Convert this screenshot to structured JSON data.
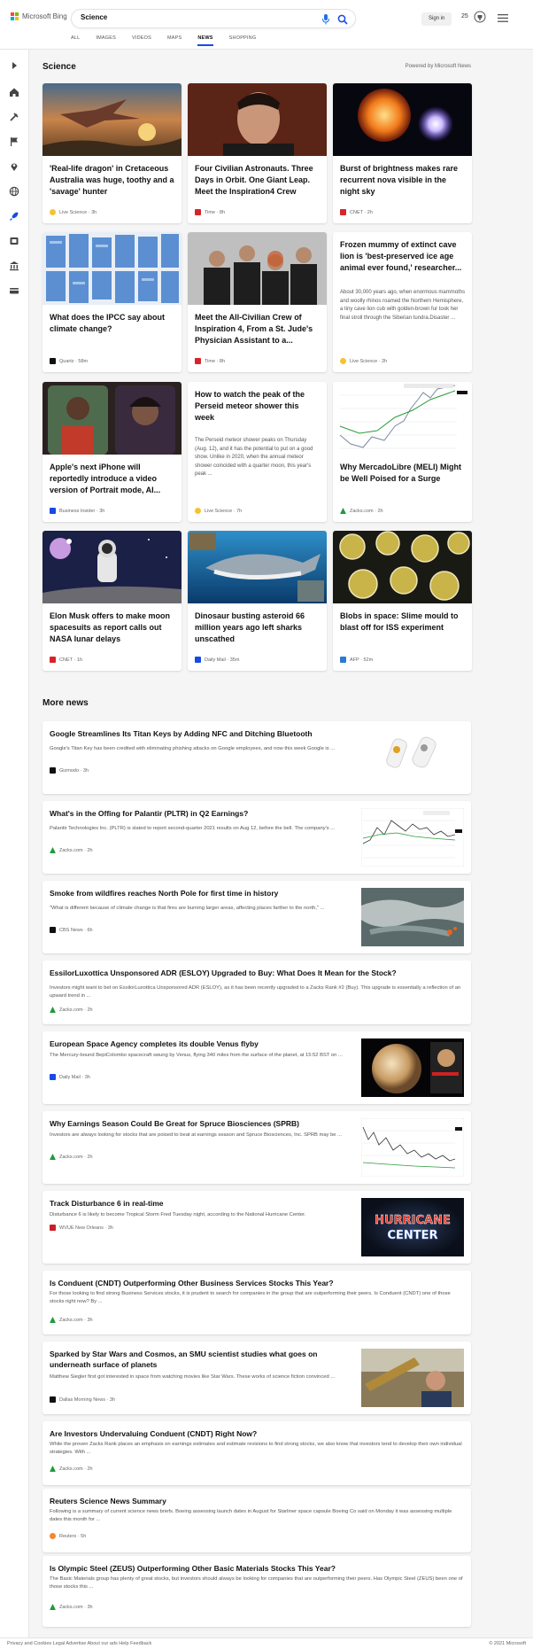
{
  "header": {
    "logo_text": "Microsoft Bing",
    "search_value": "Science",
    "signin_label": "Sign in",
    "points": "25",
    "nav": [
      "ALL",
      "IMAGES",
      "VIDEOS",
      "MAPS",
      "NEWS",
      "SHOPPING"
    ],
    "active_nav": "NEWS"
  },
  "colors": {
    "accent": "#174ae4",
    "zacks_green": "#1e9b3b",
    "cnet_red": "#d8232a"
  },
  "sidebar_icons": [
    "arrow-right-icon",
    "home-icon",
    "tools-icon",
    "flag-icon",
    "location-icon",
    "globe-icon",
    "rocket-icon",
    "media-icon",
    "building-icon",
    "card-icon"
  ],
  "science": {
    "title": "Science",
    "powered_by": "Powered by Microsoft News",
    "cards": [
      {
        "title": "'Real-life dragon' in Cretaceous Australia was huge, toothy and a 'savage' hunter",
        "source": "Live Science · 3h",
        "image": "pterosaur-sunset"
      },
      {
        "title": "Four Civilian Astronauts. Three Days in Orbit. One Giant Leap. Meet the Inspiration4 Crew",
        "source": "Time · 8h",
        "image": "astronaut-portrait"
      },
      {
        "title": "Burst of brightness makes rare recurrent nova visible in the night sky",
        "source": "CNET · 2h",
        "image": "nova-star"
      },
      {
        "title": "What does the IPCC say about climate change?",
        "source": "Quartz · 58m",
        "image": "ipcc-report-pages"
      },
      {
        "title": "Meet the All-Civilian Crew of Inspiration 4, From a St. Jude's Physician Assistant to a...",
        "source": "Time · 8h",
        "image": "crew-photo"
      },
      {
        "title": "Frozen mummy of extinct cave lion is 'best-preserved ice age animal ever found,' researcher...",
        "snippet": "About 30,000 years ago, when enormous mammoths and woolly rhinos roamed the Northern Hemisphere, a tiny cave lion cub with golden-brown fur took her final stroll through the Siberian tundra.Disaster ...",
        "source": "Live Science · 2h"
      },
      {
        "title": "Apple's next iPhone will reportedly introduce a video version of Portrait mode, AI...",
        "source": "Business Insider · 3h",
        "image": "portrait-mode-phones"
      },
      {
        "title": "How to watch the peak of the Perseid meteor shower this week",
        "snippet": "The Perseid meteor shower peaks on Thursday (Aug. 12), and it has the potential to put on a good show. Unlike in 2020, when the annual meteor shower coincided with a quarter moon, this year's peak ...",
        "source": "Live Science · 7h"
      },
      {
        "title": "Why MercadoLibre (MELI) Might be Well Poised for a Surge",
        "source": "Zacks.com · 2h",
        "image": "stock-chart"
      },
      {
        "title": "Elon Musk offers to make moon spacesuits as report calls out NASA lunar delays",
        "source": "CNET · 1h",
        "image": "moon-astronaut"
      },
      {
        "title": "Dinosaur busting asteroid 66 million years ago left sharks unscathed",
        "source": "Daily Mail · 35m",
        "image": "shark"
      },
      {
        "title": "Blobs in space: Slime mould to blast off for ISS experiment",
        "source": "AFP · 52m",
        "image": "petri-dishes"
      }
    ]
  },
  "more_news": {
    "title": "More news",
    "items": [
      {
        "title": "Google Streamlines Its Titan Keys by Adding NFC and Ditching Bluetooth",
        "snippet": "Google's Titan Key has been credited with eliminating phishing attacks on Google employees, and now this week Google is ...",
        "source": "Gizmodo · 3h",
        "image": "titan-keys"
      },
      {
        "title": "What's in the Offing for Palantir (PLTR) in Q2 Earnings?",
        "snippet": "Palantir Technologies Inc. (PLTR) is slated to report second-quarter 2021 results on Aug 12, before the bell. The company's ...",
        "source": "Zacks.com · 2h",
        "image": "stock-chart"
      },
      {
        "title": "Smoke from wildfires reaches North Pole for first time in history",
        "snippet": "\"What is different because of climate change is that fires are burning larger areas, affecting places farther to the north,\" ...",
        "source": "CBS News · 6h",
        "image": "satellite-smoke"
      },
      {
        "title": "EssilorLuxottica Unsponsored ADR (ESLOY) Upgraded to Buy: What Does It Mean for the Stock?",
        "snippet": "Investors might want to bet on EssilorLuxottica Unsponsored ADR (ESLOY), as it has been recently upgraded to a Zacks Rank #2 (Buy). This upgrade is essentially a reflection of an upward trend in ...",
        "source": "Zacks.com · 2h"
      },
      {
        "title": "European Space Agency completes its double Venus flyby",
        "snippet": "The Mercury-bound BepiColombo spacecraft swung by Venus, flying 340 miles from the surface of the planet, at 15:52 BST on ...",
        "source": "Daily Mail · 3h",
        "image": "venus"
      },
      {
        "title": "Why Earnings Season Could Be Great for Spruce Biosciences (SPRB)",
        "snippet": "Investors are always looking for stocks that are poised to beat at earnings season and Spruce Biosciences, Inc. SPRB may be ...",
        "source": "Zacks.com · 2h",
        "image": "stock-chart-2"
      },
      {
        "title": "Track Disturbance 6 in real-time",
        "snippet": "Disturbance 6 is likely to become Tropical Storm Fred Tuesday night, according to the National Hurricane Center.",
        "source": "WVUE New Orleans · 3h",
        "image": "hurricane-center",
        "image_text": [
          "HURRICANE",
          "CENTER"
        ]
      },
      {
        "title": "Is Conduent (CNDT) Outperforming Other Business Services Stocks This Year?",
        "snippet": "For those looking to find strong Business Services stocks, it is prudent to search for companies in the group that are outperforming their peers. Is Conduent (CNDT) one of those stocks right now? By ...",
        "source": "Zacks.com · 3h"
      },
      {
        "title": "Sparked by Star Wars and Cosmos, an SMU scientist studies what goes on underneath surface of planets",
        "snippet": "Matthew Siegler first got interested in space from watching movies like Star Wars. These works of science fiction convinced ...",
        "source": "Dallas Morning News · 3h",
        "image": "scientist-telescope"
      },
      {
        "title": "Are Investors Undervaluing Conduent (CNDT) Right Now?",
        "snippet": "While the proven Zacks Rank places an emphasis on earnings estimates and estimate revisions to find strong stocks, we also know that investors tend to develop their own individual strategies. With ...",
        "source": "Zacks.com · 2h"
      },
      {
        "title": "Reuters Science News Summary",
        "snippet": "Following is a summary of current science news briefs. Boeing assessing launch dates in August for Starliner space capsule Boeing Co said on Monday it was assessing multiple dates this month for ...",
        "source": "Reuters · 5h"
      },
      {
        "title": "Is Olympic Steel (ZEUS) Outperforming Other Basic Materials Stocks This Year?",
        "snippet": "The Basic Materials group has plenty of great stocks, but investors should always be looking for companies that are outperforming their peers. Has Olympic Steel (ZEUS) been one of those stocks this ...",
        "source": "Zacks.com · 3h"
      }
    ]
  },
  "footer": {
    "text": "Privacy and Cookies  Legal  Advertise  About our ads  Help  Feedback",
    "copyright": "© 2021 Microsoft"
  }
}
